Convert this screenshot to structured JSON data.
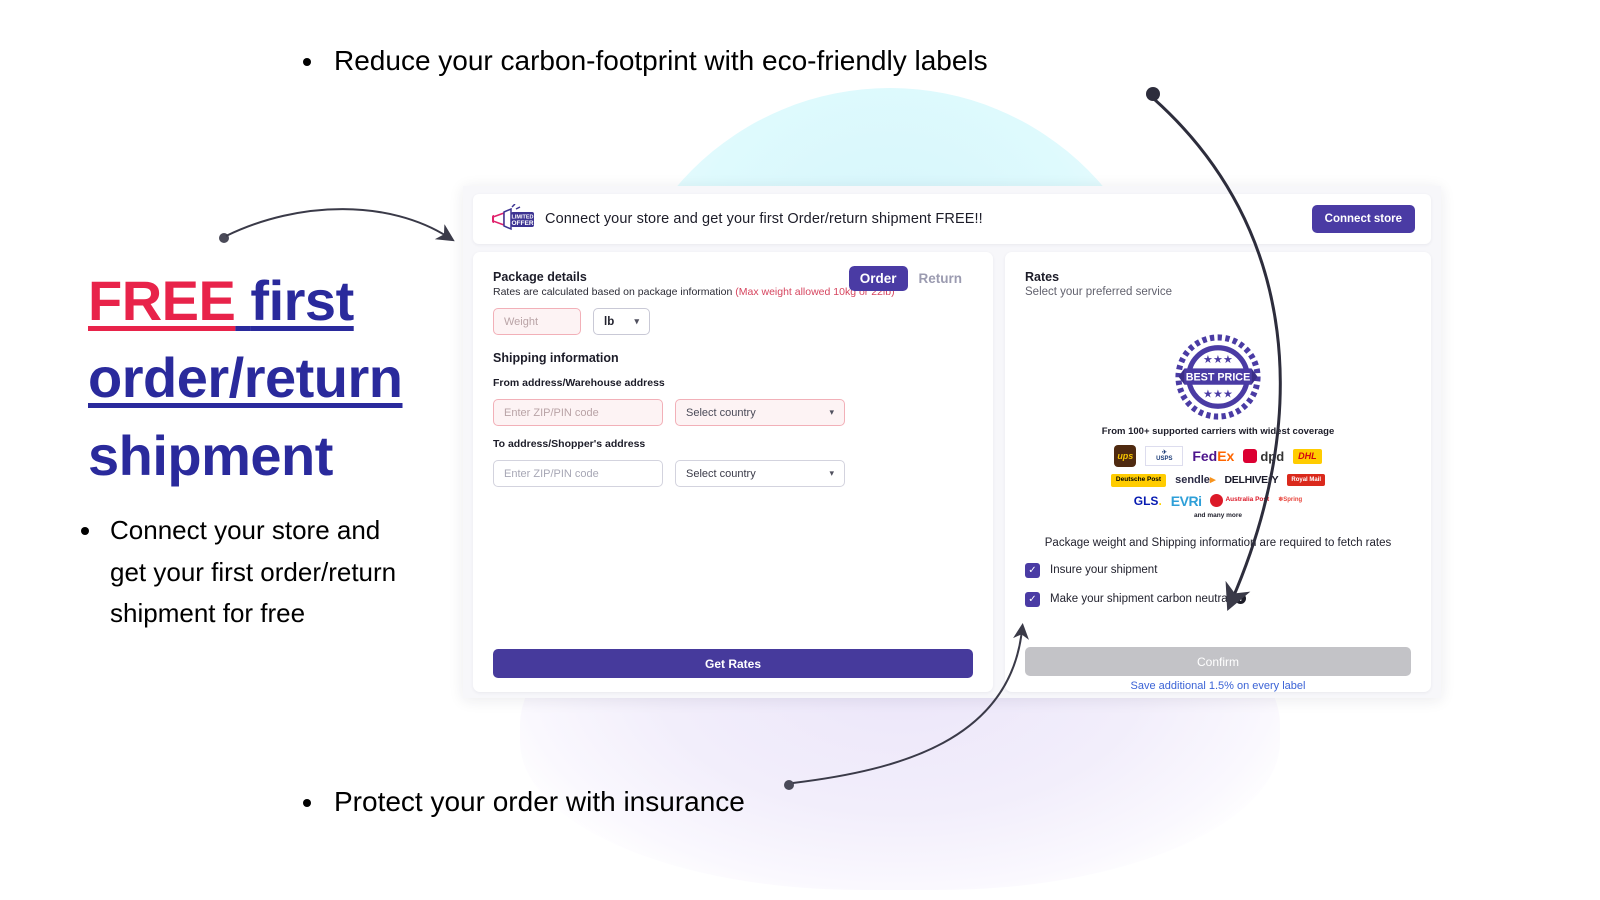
{
  "callouts": {
    "top_bullet": "Reduce your carbon-footprint with eco-friendly labels",
    "bottom_bullet": "Protect your order with insurance",
    "left_bullet": "Connect your store and get your first order/return shipment for free"
  },
  "headline": {
    "free": "FREE",
    "line1_rest": "first",
    "line2": "order/return",
    "line3": "shipment",
    "free_color": "#e8234a",
    "rest_color": "#2a2a9c"
  },
  "app": {
    "banner": {
      "icon": "megaphone-limited-offer-icon",
      "badge_line1": "LIMITED",
      "badge_line2": "OFFER",
      "text": "Connect your store and get your first Order/return shipment FREE!!",
      "button_label": "Connect store",
      "button_color": "#4a3ba4"
    },
    "left_pane": {
      "title": "Package details",
      "subtitle_main": "Rates are calculated based on package information ",
      "subtitle_warning": "(Max weight allowed 10kg or 22lb)",
      "toggle": {
        "order": "Order",
        "return": "Return",
        "selected": "Order"
      },
      "weight_placeholder": "Weight",
      "unit_value": "lb",
      "shipping_title": "Shipping information",
      "from_label": "From address/Warehouse address",
      "to_label": "To address/Shopper's address",
      "zip_placeholder": "Enter ZIP/PIN code",
      "country_placeholder": "Select country",
      "get_rates_label": "Get Rates"
    },
    "right_pane": {
      "title": "Rates",
      "subtitle": "Select your preferred service",
      "badge_text": "BEST PRICE",
      "carriers_note": "From 100+ supported carriers with widest coverage",
      "carriers": [
        [
          "ups",
          "usps",
          "fedex",
          "dpd",
          "dhl"
        ],
        [
          "deutsche-post",
          "sendle",
          "delhivery",
          "royal-mail"
        ],
        [
          "gls",
          "evri",
          "australia-post",
          "spring"
        ]
      ],
      "carrier_labels": {
        "ups": "ups",
        "usps": "UNITED STATES POSTAL SERVICE",
        "fedex_fed": "Fed",
        "fedex_ex": "Ex",
        "dpd": "dpd",
        "dhl": "DHL",
        "deutsche_post": "Deutsche Post",
        "sendle": "sendle",
        "delhivery": "DELHIVErY",
        "royal_mail": "Royal Mail",
        "gls": "GLS",
        "evri": "EVRi",
        "australia_post": "Australia Post",
        "spring": "Spring"
      },
      "many_more": "and many more",
      "required_note": "Package weight and Shipping information are required to fetch rates",
      "checkbox_insure": "Insure your shipment",
      "checkbox_carbon": "Make your shipment carbon neutral",
      "info_glyph": "i",
      "confirm_label": "Confirm",
      "save_note": "Save additional 1.5% on every label"
    }
  }
}
